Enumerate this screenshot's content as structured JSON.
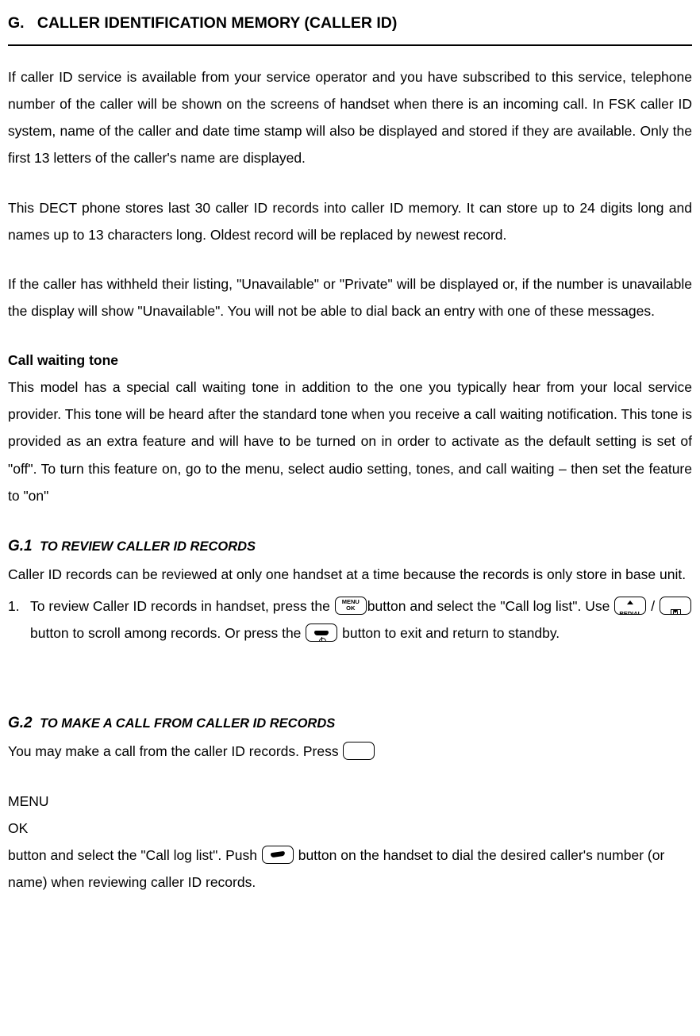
{
  "section": {
    "letter": "G.",
    "title": "CALLER IDENTIFICATION MEMORY (CALLER ID)"
  },
  "para1": "If caller ID service is available from your service operator and you have subscribed to this service, telephone number of the caller will be shown on the screens of handset when there is an incoming call. In FSK caller ID system, name of the caller and date time stamp will also be displayed and stored if they are available. Only the first 13 letters of the caller's name are displayed.",
  "para2": "This DECT phone stores last 30 caller ID records into caller ID memory. It can store up to 24 digits long and names up to 13 characters long. Oldest record will be replaced by newest record.",
  "para3": "If the caller has withheld their listing, \"Unavailable\" or \"Private\" will be displayed or, if the number is unavailable the display will show \"Unavailable\". You will not be able to dial back an entry with one of these messages.",
  "cw_heading": "Call waiting tone",
  "para4": "This model has a special call waiting tone in addition to the one you typically hear from your local service provider. This tone will be heard after the standard tone when you receive a call waiting notification. This tone is provided as an extra feature and will have to be turned on in order to activate as the default setting is set of \"off\". To turn this feature on, go to the menu, select audio setting, tones, and call waiting – then set the feature to \"on\"",
  "g1": {
    "num": "G.1",
    "title": "TO REVIEW CALLER ID RECORDS",
    "intro": "Caller ID records can be reviewed at only one handset at a time because the records is only store in base unit.",
    "step_pre": "To review Caller ID records in handset, press the ",
    "step_mid1": "button and select the \"Call log list\". Use ",
    "step_slash": " / ",
    "step_mid2": " button to scroll among records. Or press the ",
    "step_end": " button to exit and return to standby."
  },
  "g2": {
    "num": "G.2",
    "title": "TO MAKE A CALL FROM CALLER ID RECORDS",
    "pre": "You may make a call from the caller ID records. Press ",
    "mid1": " button and select the \"Call log list\". Push ",
    "mid2": " button on the handset to ",
    "end": "dial the desired caller's number (or name) when reviewing caller ID records."
  },
  "icons": {
    "menu_l1": "MENU",
    "menu_l2": "OK",
    "redial": "REDIAL"
  }
}
